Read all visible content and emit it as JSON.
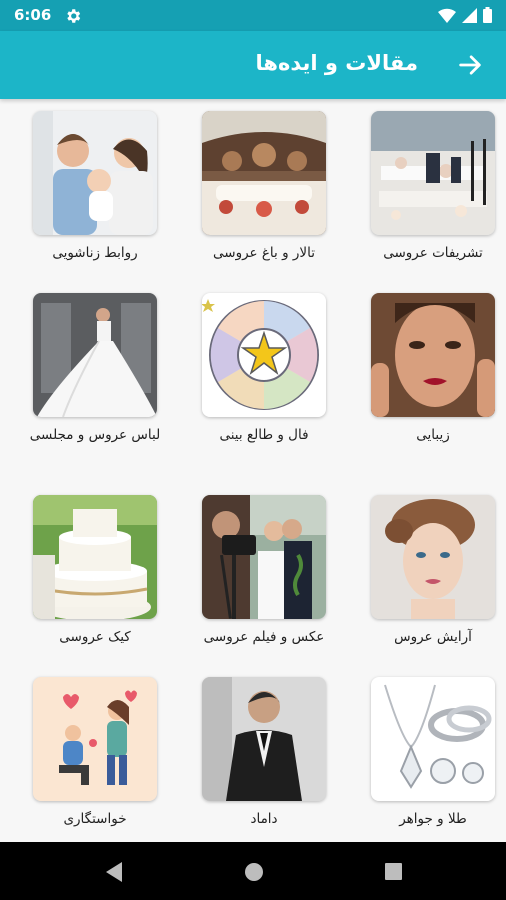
{
  "status_bar": {
    "time": "6:06",
    "icons": [
      "settings-icon",
      "wifi-icon",
      "signal-icon",
      "battery-icon"
    ]
  },
  "app_bar": {
    "title": "مقالات و ایده‌ها",
    "back_icon": "arrow-right-icon",
    "color": "#1cb5c8"
  },
  "categories": [
    {
      "label": "تشریفات عروسی",
      "image": "wedding-reception-photo"
    },
    {
      "label": "تالار و باغ عروسی",
      "image": "wedding-hall-garden-photo"
    },
    {
      "label": "روابط زناشویی",
      "image": "couple-with-baby-photo"
    },
    {
      "label": "زیبایی",
      "image": "woman-beauty-portrait-photo"
    },
    {
      "label": "فال و طالع بینی",
      "image": "zodiac-wheel-illustration"
    },
    {
      "label": "لباس عروس و مجلسی",
      "image": "wedding-dress-photo"
    },
    {
      "label": "آرایش عروس",
      "image": "bride-makeup-photo"
    },
    {
      "label": "عکس و فیلم عروسی",
      "image": "wedding-photographer-photo"
    },
    {
      "label": "کیک عروسی",
      "image": "wedding-cake-photo"
    },
    {
      "label": "طلا و جواهر",
      "image": "jewelry-photo"
    },
    {
      "label": "داماد",
      "image": "groom-suit-photo"
    },
    {
      "label": "خواستگاری",
      "image": "proposal-illustration"
    }
  ],
  "nav_bar": {
    "icons": [
      "back-triangle-icon",
      "home-circle-icon",
      "recents-square-icon"
    ]
  }
}
